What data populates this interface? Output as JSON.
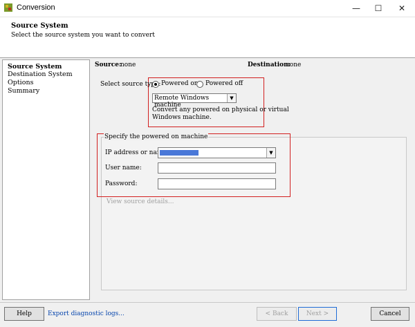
{
  "window": {
    "title": "Conversion",
    "minimize": "—",
    "maximize": "☐",
    "close": "✕"
  },
  "header": {
    "title": "Source System",
    "subtitle": "Select the source system you want to convert"
  },
  "sidebar": {
    "items": [
      {
        "label": "Source System",
        "active": true
      },
      {
        "label": "Destination System",
        "active": false
      },
      {
        "label": "Options",
        "active": false
      },
      {
        "label": "Summary",
        "active": false
      }
    ]
  },
  "status": {
    "source_label": "Source:",
    "source_value": "none",
    "destination_label": "Destination:",
    "destination_value": "none"
  },
  "source_type": {
    "label": "Select source type:",
    "option_on": "Powered on",
    "option_off": "Powered off",
    "selected": "Powered on",
    "machine_type": "Remote Windows machine",
    "description_line1": "Convert any powered on physical or virtual",
    "description_line2": "Windows machine."
  },
  "machine": {
    "group_label": "Specify the powered on machine",
    "ip_label": "IP address or name:",
    "ip_value": "",
    "user_label": "User name:",
    "user_value": "",
    "password_label": "Password:",
    "password_value": "",
    "view_details": "View source details..."
  },
  "footer": {
    "help": "Help",
    "export_logs": "Export diagnostic logs...",
    "back": "< Back",
    "next": "Next >",
    "cancel": "Cancel"
  },
  "colors": {
    "highlight_box": "#d21e1e",
    "link": "#0645ad",
    "redaction": "#4a78d8"
  }
}
